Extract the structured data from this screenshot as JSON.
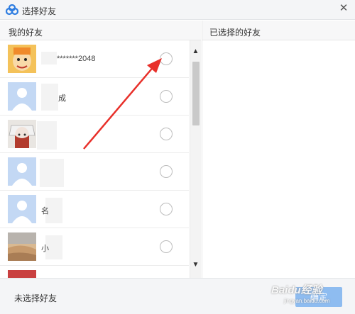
{
  "window": {
    "title": "选择好友",
    "close_glyph": "✕"
  },
  "left_panel": {
    "header": "我的好友"
  },
  "right_panel": {
    "header": "已选择的好友"
  },
  "friends": [
    {
      "name": "*******2048",
      "avatar": "cartoon-avatar"
    },
    {
      "name": "成",
      "avatar": "default-avatar"
    },
    {
      "name": "",
      "avatar": "photo-avatar"
    },
    {
      "name": "",
      "avatar": "default-avatar"
    },
    {
      "name": "名",
      "avatar": "default-avatar"
    },
    {
      "name": "小",
      "avatar": "landscape-avatar"
    },
    {
      "name": "",
      "avatar": "red-avatar"
    }
  ],
  "scrollbar": {
    "up_glyph": "▲",
    "down_glyph": "▼"
  },
  "footer": {
    "status_text": "未选择好友",
    "confirm_label": "确定"
  },
  "watermark": {
    "text": "Baidu经验",
    "sub": "jingyan.baidu.com"
  },
  "colors": {
    "confirm_button": "#8ebcf0",
    "arrow": "#e8302a"
  }
}
